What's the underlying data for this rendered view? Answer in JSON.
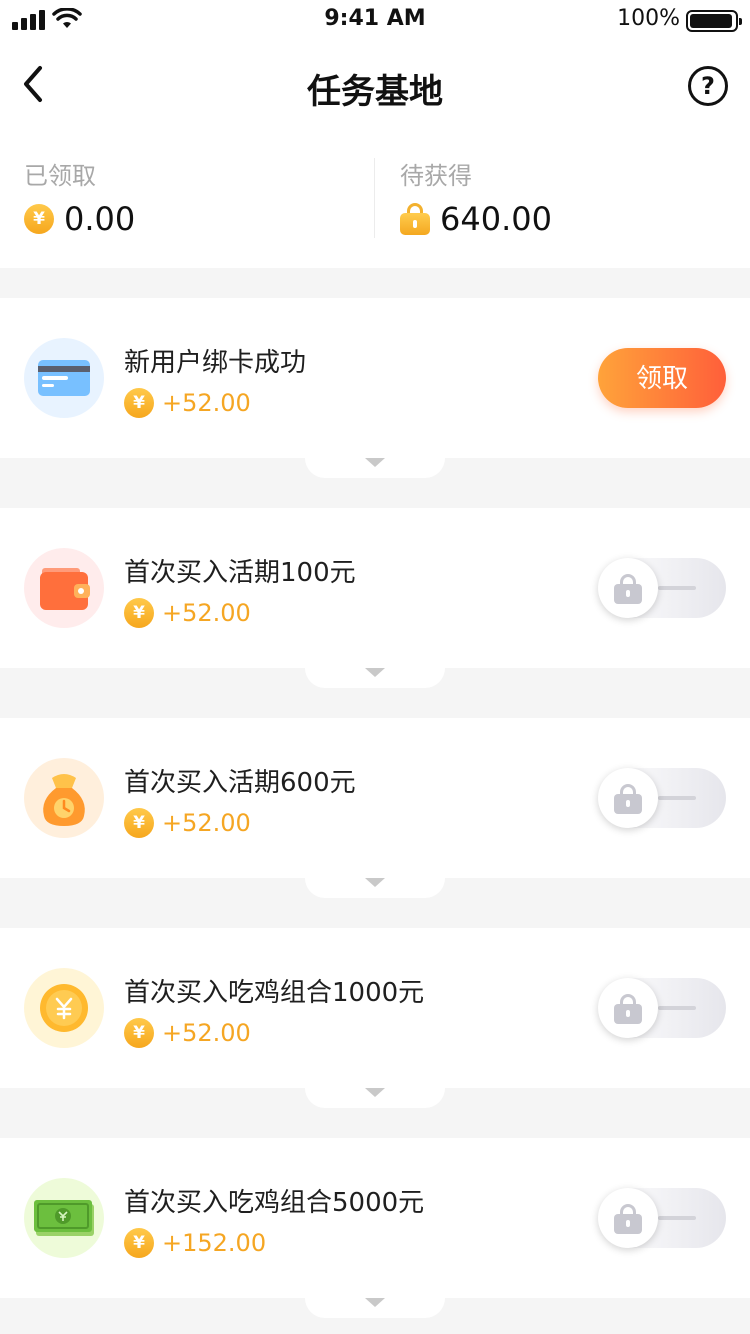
{
  "status_bar": {
    "time": "9:41 AM",
    "battery": "100%"
  },
  "nav": {
    "title": "任务基地",
    "help_label": "?"
  },
  "summary": {
    "claimed_label": "已领取",
    "claimed_amount": "0.00",
    "pending_label": "待获得",
    "pending_amount": "640.00"
  },
  "coin_symbol": "¥",
  "tasks": [
    {
      "name": "新用户绑卡成功",
      "reward": "+52.00",
      "action": "领取",
      "icon": "bank-card-icon",
      "state": "claimable"
    },
    {
      "name": "首次买入活期100元",
      "reward": "+52.00",
      "icon": "wallet-icon",
      "state": "locked"
    },
    {
      "name": "首次买入活期600元",
      "reward": "+52.00",
      "icon": "money-bag-icon",
      "state": "locked"
    },
    {
      "name": "首次买入吃鸡组合1000元",
      "reward": "+52.00",
      "icon": "coin-icon",
      "state": "locked"
    },
    {
      "name": "首次买入吃鸡组合5000元",
      "reward": "+152.00",
      "icon": "banknote-icon",
      "state": "locked"
    }
  ],
  "colors": {
    "accent_orange": "#ff5f3a",
    "reward_gold": "#f5a623",
    "label_gray": "#a8a8a8"
  }
}
